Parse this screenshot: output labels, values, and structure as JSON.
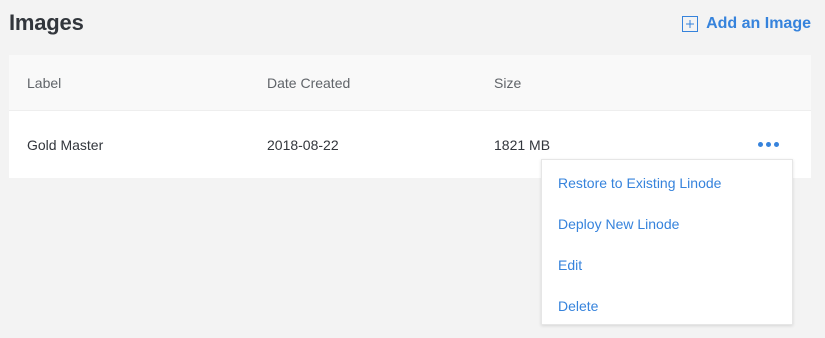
{
  "header": {
    "title": "Images",
    "add_image_label": "Add an Image",
    "add_icon": "plus-square-icon"
  },
  "table": {
    "columns": [
      "Label",
      "Date Created",
      "Size"
    ],
    "rows": [
      {
        "label": "Gold Master",
        "date_created": "2018-08-22",
        "size": "1821 MB"
      }
    ]
  },
  "action_menu": {
    "trigger_icon": "more-horizontal-icon",
    "items": [
      "Restore to Existing Linode",
      "Deploy New Linode",
      "Edit",
      "Delete"
    ]
  },
  "colors": {
    "accent": "#3683dc",
    "background": "#f3f3f3",
    "header_row": "#f9f9f9",
    "text": "#32363c"
  }
}
